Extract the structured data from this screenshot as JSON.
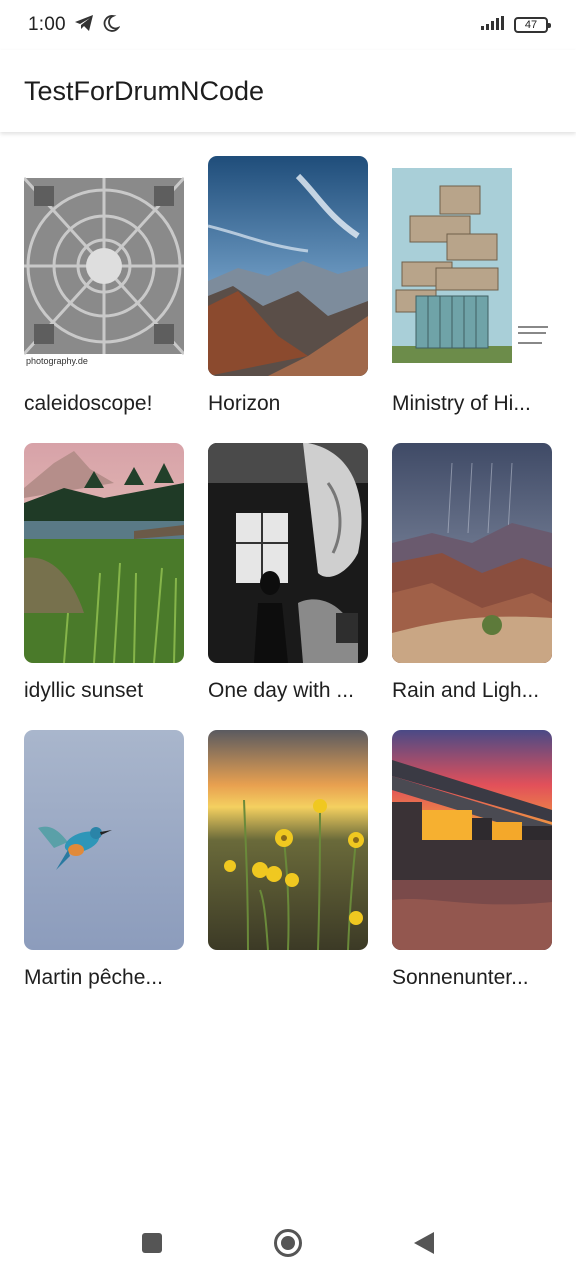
{
  "status_bar": {
    "time": "1:00",
    "battery": "47",
    "icons": [
      "telegram-icon",
      "moon-icon",
      "signal-icon",
      "battery-icon"
    ]
  },
  "app_bar": {
    "title": "TestForDrumNCode"
  },
  "gallery": {
    "items": [
      {
        "caption": "caleidoscope!",
        "photo_text": "photography.de"
      },
      {
        "caption": "Horizon"
      },
      {
        "caption": "Ministry of Hi..."
      },
      {
        "caption": "idyllic sunset"
      },
      {
        "caption": "One day with ..."
      },
      {
        "caption": "Rain and Ligh..."
      },
      {
        "caption": "Martin pêche..."
      },
      {
        "caption": ""
      },
      {
        "caption": "Sonnenunter..."
      }
    ]
  },
  "nav_bar": {
    "buttons": [
      "recents-square-icon",
      "home-circle-icon",
      "back-triangle-icon"
    ]
  },
  "colors": {
    "background": "#ffffff",
    "text": "#1d1d1d",
    "nav_icon": "#555555"
  }
}
